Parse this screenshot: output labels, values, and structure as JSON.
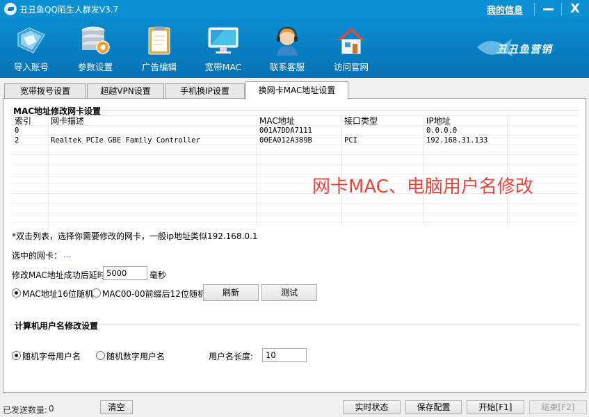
{
  "window": {
    "title": "丑丑鱼QQ陌生人群发V3.7",
    "my_info": "我的信息",
    "close_glyph": "X"
  },
  "toolbar": {
    "items": [
      {
        "label": "导入账号",
        "icon": "folder-import-icon"
      },
      {
        "label": "参数设置",
        "icon": "server-gear-icon"
      },
      {
        "label": "广告编辑",
        "icon": "clipboard-icon"
      },
      {
        "label": "宽带MAC",
        "icon": "monitor-icon"
      },
      {
        "label": "联系客服",
        "icon": "headset-agent-icon"
      },
      {
        "label": "访问官网",
        "icon": "house-icon"
      }
    ],
    "brand": "丑丑鱼营销"
  },
  "tabs": [
    {
      "label": "宽带拨号设置"
    },
    {
      "label": "超越VPN设置"
    },
    {
      "label": "手机换IP设置"
    },
    {
      "label": "换网卡MAC地址设置"
    }
  ],
  "mac_section": {
    "title": "MAC地址修改网卡设置",
    "columns": [
      "索引",
      "网卡描述",
      "MAC地址",
      "接口类型",
      "IP地址"
    ],
    "rows": [
      [
        "0",
        "",
        "001A7DDA7111",
        "",
        "0.0.0.0"
      ],
      [
        "2",
        "Realtek PCIe GBE Family Controller",
        "00EA012A389B",
        "PCI",
        "192.168.31.133"
      ]
    ],
    "watermark": "网卡MAC、电脑用户名修改",
    "hint": "*双击列表，选择你需要修改的网卡，一般ip地址类似192.168.0.1",
    "selected_label": "选中的网卡：",
    "selected_value": "...",
    "delay_label": "修改MAC地址成功后延时",
    "delay_value": "5000",
    "delay_unit": "毫秒",
    "radio1": "MAC地址16位随机",
    "radio2": "MAC00-00前缀后12位随机",
    "refresh_btn": "刷新",
    "test_btn": "测试"
  },
  "user_section": {
    "title": "计算机用户名修改设置",
    "radio1": "随机字母用户名",
    "radio2": "随机数字用户名",
    "length_label": "用户名长度:",
    "length_value": "10"
  },
  "status": {
    "sent_label": "已发送数量:",
    "sent_count": "0",
    "clear_btn": "清空",
    "realtime_btn": "实时状态",
    "save_btn": "保存配置",
    "start_btn": "开始[F1]",
    "stop_btn": "结束[F2]"
  },
  "colors": {
    "titlebar": "#0a8fd3",
    "toolbar": "#0671b4",
    "watermark": "#e8453c"
  }
}
